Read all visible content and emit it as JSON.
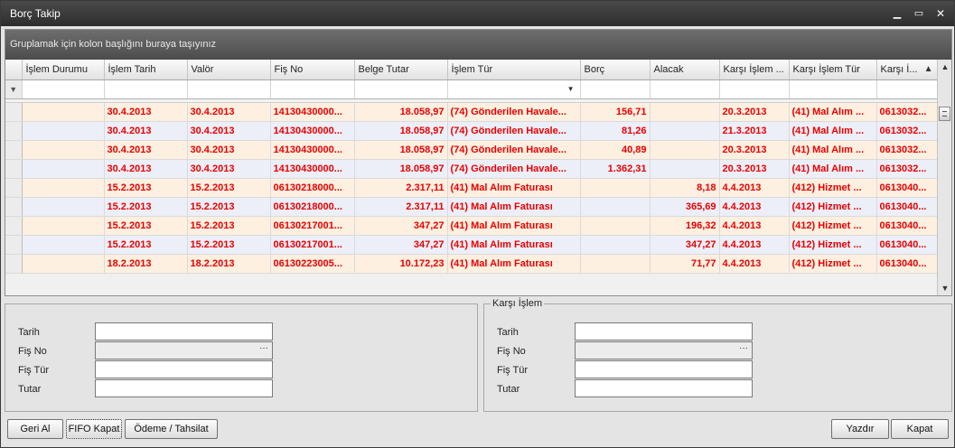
{
  "window": {
    "title": "Borç Takip",
    "minimize_icon": "minimize-icon",
    "maximize_icon": "maximize-icon",
    "close_icon": "close-icon"
  },
  "grid": {
    "group_panel_text": "Gruplamak için kolon başlığını buraya taşıyınız",
    "columns": [
      "İşlem Durumu",
      "İşlem Tarih",
      "Valör",
      "Fiş No",
      "Belge Tutar",
      "İşlem Tür",
      "Borç",
      "Alacak",
      "Karşı İşlem ...",
      "Karşı İşlem Tür",
      "Karşı İ..."
    ],
    "rows": [
      {
        "durum": "",
        "tarih": "30.4.2013",
        "valor": "30.4.2013",
        "fis_no": "14130430000...",
        "belge_tutar": "18.058,97",
        "islem_tur": "(74) Gönderilen Havale...",
        "borc": "156,71",
        "alacak": "",
        "karsi_tarih": "20.3.2013",
        "karsi_tur": "(41) Mal Alım ...",
        "karsi_no": "0613032..."
      },
      {
        "durum": "",
        "tarih": "30.4.2013",
        "valor": "30.4.2013",
        "fis_no": "14130430000...",
        "belge_tutar": "18.058,97",
        "islem_tur": "(74) Gönderilen Havale...",
        "borc": "81,26",
        "alacak": "",
        "karsi_tarih": "21.3.2013",
        "karsi_tur": "(41) Mal Alım ...",
        "karsi_no": "0613032..."
      },
      {
        "durum": "",
        "tarih": "30.4.2013",
        "valor": "30.4.2013",
        "fis_no": "14130430000...",
        "belge_tutar": "18.058,97",
        "islem_tur": "(74) Gönderilen Havale...",
        "borc": "40,89",
        "alacak": "",
        "karsi_tarih": "20.3.2013",
        "karsi_tur": "(41) Mal Alım ...",
        "karsi_no": "0613032..."
      },
      {
        "durum": "",
        "tarih": "30.4.2013",
        "valor": "30.4.2013",
        "fis_no": "14130430000...",
        "belge_tutar": "18.058,97",
        "islem_tur": "(74) Gönderilen Havale...",
        "borc": "1.362,31",
        "alacak": "",
        "karsi_tarih": "20.3.2013",
        "karsi_tur": "(41) Mal Alım ...",
        "karsi_no": "0613032..."
      },
      {
        "durum": "",
        "tarih": "15.2.2013",
        "valor": "15.2.2013",
        "fis_no": "06130218000...",
        "belge_tutar": "2.317,11",
        "islem_tur": "(41) Mal Alım Faturası",
        "borc": "",
        "alacak": "8,18",
        "karsi_tarih": "4.4.2013",
        "karsi_tur": "(412) Hizmet ...",
        "karsi_no": "0613040..."
      },
      {
        "durum": "",
        "tarih": "15.2.2013",
        "valor": "15.2.2013",
        "fis_no": "06130218000...",
        "belge_tutar": "2.317,11",
        "islem_tur": "(41) Mal Alım Faturası",
        "borc": "",
        "alacak": "365,69",
        "karsi_tarih": "4.4.2013",
        "karsi_tur": "(412) Hizmet ...",
        "karsi_no": "0613040..."
      },
      {
        "durum": "",
        "tarih": "15.2.2013",
        "valor": "15.2.2013",
        "fis_no": "06130217001...",
        "belge_tutar": "347,27",
        "islem_tur": "(41) Mal Alım Faturası",
        "borc": "",
        "alacak": "196,32",
        "karsi_tarih": "4.4.2013",
        "karsi_tur": "(412) Hizmet ...",
        "karsi_no": "0613040..."
      },
      {
        "durum": "",
        "tarih": "15.2.2013",
        "valor": "15.2.2013",
        "fis_no": "06130217001...",
        "belge_tutar": "347,27",
        "islem_tur": "(41) Mal Alım Faturası",
        "borc": "",
        "alacak": "347,27",
        "karsi_tarih": "4.4.2013",
        "karsi_tur": "(412) Hizmet ...",
        "karsi_no": "0613040..."
      },
      {
        "durum": "",
        "tarih": "18.2.2013",
        "valor": "18.2.2013",
        "fis_no": "06130223005...",
        "belge_tutar": "10.172,23",
        "islem_tur": "(41) Mal Alım Faturası",
        "borc": "",
        "alacak": "71,77",
        "karsi_tarih": "4.4.2013",
        "karsi_tur": "(412) Hizmet ...",
        "karsi_no": "0613040..."
      }
    ],
    "row_text_color": "#ea0000"
  },
  "left_panel": {
    "tarih_label": "Tarih",
    "fis_no_label": "Fiş No",
    "fis_tur_label": "Fiş Tür",
    "tutar_label": "Tutar",
    "ellipsis": "···"
  },
  "right_panel": {
    "legend": "Karşı İşlem",
    "tarih_label": "Tarih",
    "fis_no_label": "Fiş No",
    "fis_tur_label": "Fiş Tür",
    "tutar_label": "Tutar",
    "ellipsis": "···"
  },
  "buttons": {
    "geri_al": "Geri Al",
    "fifo_kapat": "FIFO Kapat",
    "odeme_tahsilat": "Ödeme / Tahsilat",
    "yazdir": "Yazdır",
    "kapat": "Kapat"
  }
}
